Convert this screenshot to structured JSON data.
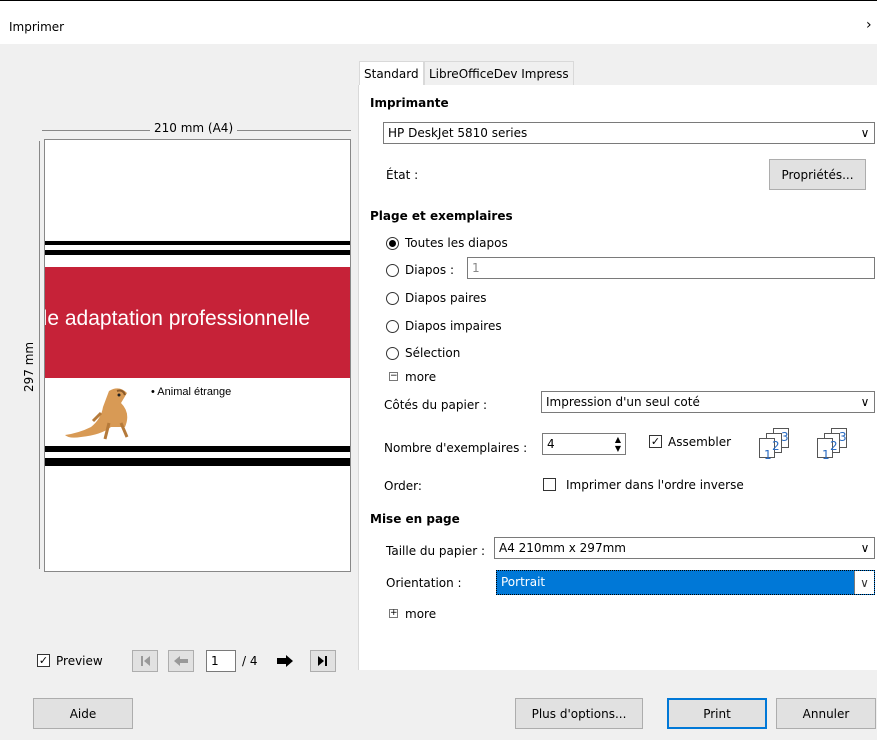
{
  "dialog": {
    "title": "Imprimer"
  },
  "preview": {
    "width_label": "210 mm (A4)",
    "height_label": "297 mm",
    "slide_title": "ule adaptation professionnelle",
    "bullet": "• Animal étrange",
    "checkbox_label": "Preview",
    "current_page": "1",
    "total_pages": "/ 4"
  },
  "tabs": [
    {
      "label": "Standard"
    },
    {
      "label": "LibreOfficeDev Impress"
    }
  ],
  "printer": {
    "section_title": "Imprimante",
    "selected": "HP DeskJet 5810 series",
    "status_label": "État :",
    "properties_button": "Propriétés..."
  },
  "range": {
    "section_title": "Plage et exemplaires",
    "options": [
      "Toutes les diapos",
      "Diapos :",
      "Diapos paires",
      "Diapos impaires",
      "Sélection"
    ],
    "slides_value": "1",
    "more_label": "more",
    "sides_label": "Côtés du papier :",
    "sides_value": "Impression d'un seul coté",
    "copies_label": "Nombre d'exemplaires :",
    "copies_value": "4",
    "collate_label": "Assembler",
    "order_label": "Order:",
    "reverse_label": "Imprimer dans l'ordre inverse",
    "collate_icon_numbers": [
      "1",
      "2",
      "3"
    ]
  },
  "layout": {
    "section_title": "Mise en page",
    "paper_size_label": "Taille du papier :",
    "paper_size_value": "A4 210mm x 297mm",
    "orientation_label": "Orientation :",
    "orientation_value": "Portrait",
    "more_label": "more"
  },
  "buttons": {
    "help": "Aide",
    "more_options": "Plus d'options...",
    "print": "Print",
    "cancel": "Annuler"
  },
  "colors": {
    "slide_band": "#c62238",
    "selection": "#0078d7",
    "collate_numbers": "#2a6cc3"
  }
}
